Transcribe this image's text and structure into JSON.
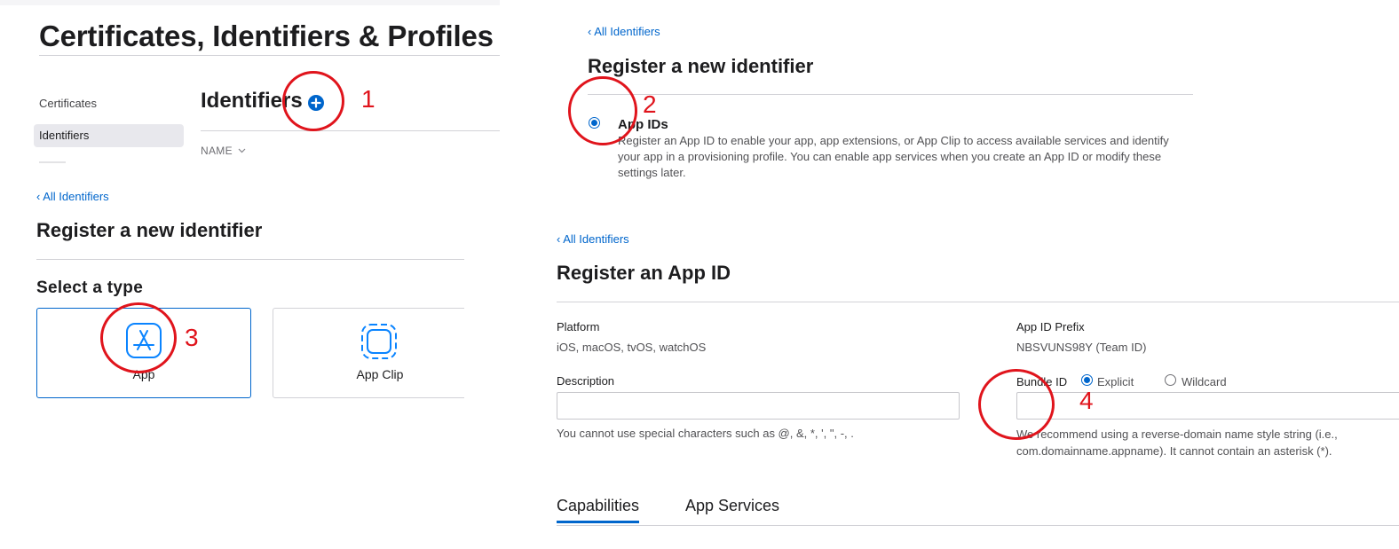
{
  "panel1": {
    "title": "Certificates, Identifiers & Profiles",
    "sidebar": [
      "Certificates",
      "Identifiers"
    ],
    "section_title": "Identifiers",
    "column_header": "NAME",
    "sort_icon": "chevron-down-icon",
    "add_icon": "plus-circle-icon"
  },
  "panel2": {
    "back_link": "‹ All Identifiers",
    "title": "Register a new identifier",
    "option_title": "App IDs",
    "option_desc_1": "Register an App ID to enable your app, app extensions, or App Clip to access available services and identify",
    "option_desc_2": "your app in a provisioning profile. You can enable app services when you create an App ID or modify these",
    "option_desc_3": "settings later."
  },
  "panel3": {
    "back_link": "‹ All Identifiers",
    "title": "Register a new identifier",
    "subtitle": "Select a type",
    "types": [
      {
        "label": "App",
        "icon": "app-store-icon",
        "selected": true
      },
      {
        "label": "App Clip",
        "icon": "app-clip-icon",
        "selected": false
      }
    ]
  },
  "panel4": {
    "back_link": "‹ All Identifiers",
    "title": "Register an App ID",
    "platform_label": "Platform",
    "platform_value": "iOS, macOS, tvOS, watchOS",
    "prefix_label": "App ID Prefix",
    "prefix_value": "NBSVUNS98Y (Team ID)",
    "description_label": "Description",
    "description_value": "",
    "description_hint": "You cannot use special characters such as @, &, *, ', \", -, .",
    "bundle_label": "Bundle ID",
    "bundle_options": [
      "Explicit",
      "Wildcard"
    ],
    "bundle_value": "",
    "bundle_hint_1": "We recommend using a reverse-domain name style string (i.e.,",
    "bundle_hint_2": "com.domainname.appname). It cannot contain an asterisk (*).",
    "tabs": [
      "Capabilities",
      "App Services"
    ]
  },
  "annotations": [
    "1",
    "2",
    "3",
    "4"
  ],
  "colors": {
    "accent": "#0066cc",
    "annotation": "#e0141c",
    "rule": "#d2d2d7"
  }
}
